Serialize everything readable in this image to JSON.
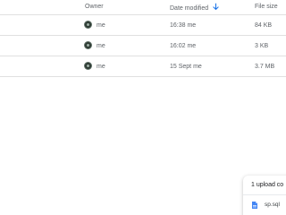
{
  "columns": {
    "owner": "Owner",
    "date_modified": "Date modified",
    "file_size": "File size",
    "sort_icon": "arrow-down-icon"
  },
  "rows": [
    {
      "owner": "me",
      "date_modified": "16:38 me",
      "file_size": "84 KB"
    },
    {
      "owner": "me",
      "date_modified": "16:02 me",
      "file_size": "3 KB"
    },
    {
      "owner": "me",
      "date_modified": "15 Sept me",
      "file_size": "3.7 MB"
    }
  ],
  "upload_panel": {
    "title": "1 upload co",
    "file_name": "sp.sql",
    "file_icon": "document-icon"
  },
  "colors": {
    "accent": "#1a73e8",
    "divider": "#e0e0e0",
    "text": "#5f6368"
  }
}
